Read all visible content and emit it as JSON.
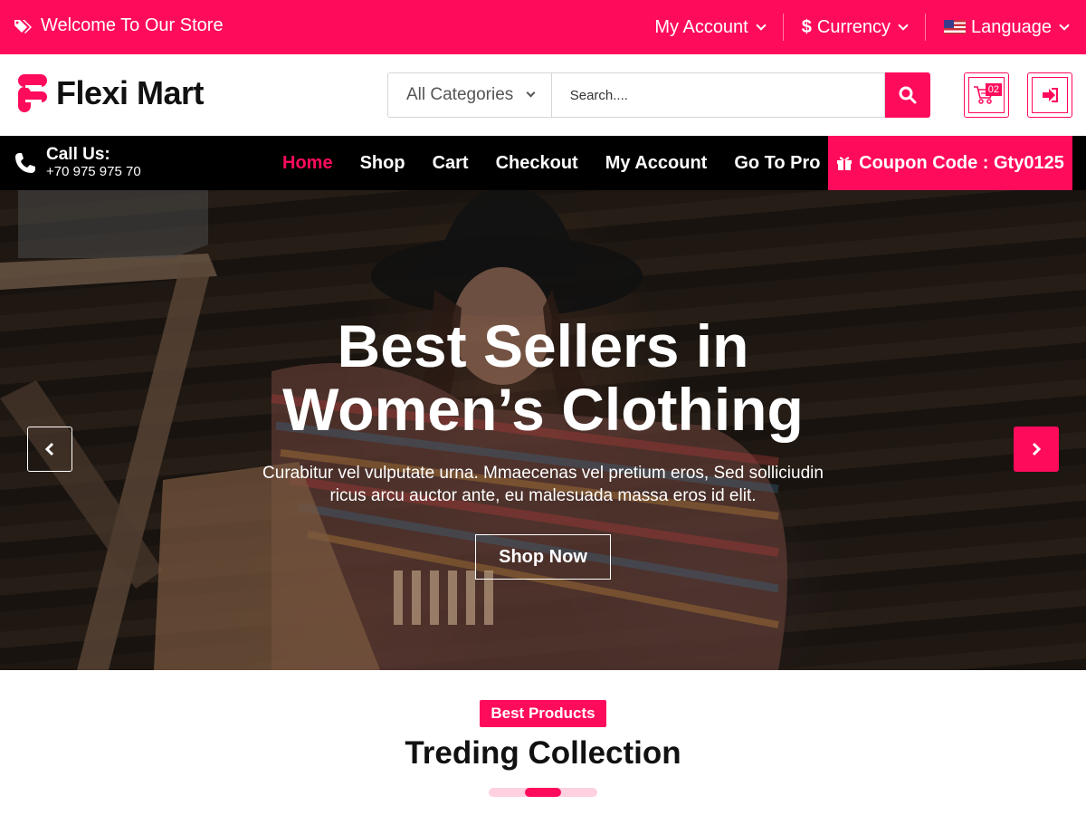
{
  "colors": {
    "accent": "#ff0b5c",
    "nav_bg": "#000000",
    "white": "#ffffff"
  },
  "topbar": {
    "welcome": "Welcome To Our Store",
    "welcome_icon": "tags-icon",
    "my_account": "My Account",
    "currency": "Currency",
    "currency_icon": "dollar-icon",
    "language": "Language",
    "language_icon": "us-flag-icon"
  },
  "header": {
    "logo_text": "Flexi Mart",
    "category_select": "All Categories",
    "search_placeholder": "Search....",
    "search_icon": "search-icon",
    "cart_count": "02",
    "cart_icon": "cart-icon",
    "login_icon": "sign-in-icon"
  },
  "nav": {
    "call_label": "Call Us:",
    "call_number": "+70 975 975 70",
    "links": [
      {
        "label": "Home",
        "active": true
      },
      {
        "label": "Shop",
        "active": false
      },
      {
        "label": "Cart",
        "active": false
      },
      {
        "label": "Checkout",
        "active": false
      },
      {
        "label": "My Account",
        "active": false
      },
      {
        "label": "Go To Pro",
        "active": false
      }
    ],
    "coupon": "Coupon Code : Gty0125",
    "coupon_icon": "gift-icon"
  },
  "hero": {
    "title_line1": "Best Sellers in",
    "title_line2": "Women’s Clothing",
    "text_line1": "Curabitur vel vulputate urna. Mmaecenas vel pretium eros, Sed solliciudin",
    "text_line2": "ricus arcu auctor ante, eu malesuada massa eros id elit.",
    "button": "Shop Now",
    "prev_icon": "chevron-left-icon",
    "next_icon": "chevron-right-icon"
  },
  "section": {
    "pill": "Best Products",
    "title": "Treding Collection"
  }
}
